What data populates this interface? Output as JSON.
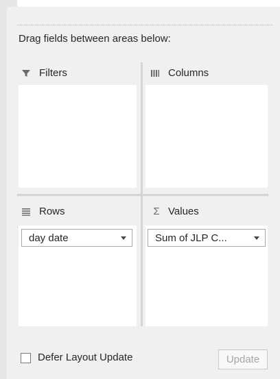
{
  "instructions": "Drag fields between areas below:",
  "areas": {
    "filters": {
      "label": "Filters",
      "icon": "filter-icon",
      "fields": []
    },
    "columns": {
      "label": "Columns",
      "icon": "columns-icon",
      "fields": []
    },
    "rows": {
      "label": "Rows",
      "icon": "rows-icon",
      "fields": [
        {
          "label": "day date"
        }
      ]
    },
    "values": {
      "label": "Values",
      "icon": "sigma-icon",
      "fields": [
        {
          "label": "Sum of JLP C..."
        }
      ]
    }
  },
  "footer": {
    "defer_label": "Defer Layout Update",
    "defer_checked": false,
    "update_label": "Update",
    "update_enabled": false
  },
  "colors": {
    "pane_bg": "#f0f0f0",
    "box_bg": "#ffffff",
    "divider": "#d4d4d4",
    "disabled_text": "#a6a6a6"
  }
}
